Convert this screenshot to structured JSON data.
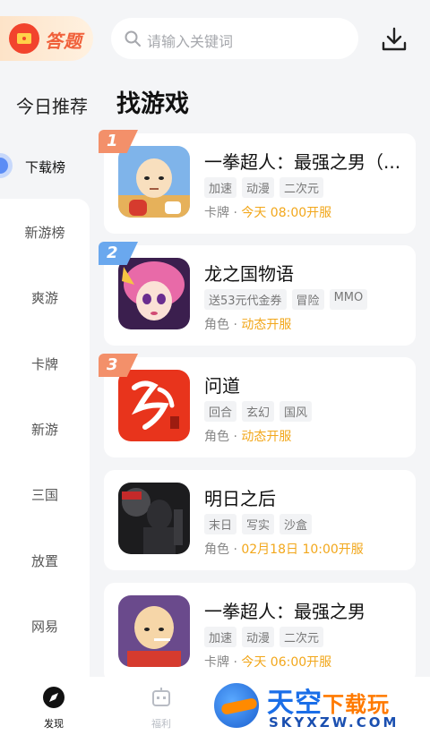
{
  "header": {
    "quiz_label": "答题",
    "search_placeholder": "请输入关键词"
  },
  "sidebar": {
    "today_label": "今日推荐",
    "active_label": "下载榜",
    "items": [
      "新游榜",
      "爽游",
      "卡牌",
      "新游",
      "三国",
      "放置",
      "网易"
    ]
  },
  "main": {
    "title": "找游戏",
    "games": [
      {
        "rank": "1",
        "name": "一拳超人：最强之男（...",
        "tags": [
          "加速",
          "动漫",
          "二次元"
        ],
        "category": "卡牌",
        "sep": "·",
        "time": "今天 08:00开服"
      },
      {
        "rank": "2",
        "name": "龙之国物语",
        "tags": [
          "送53元代金券",
          "冒险",
          "MMO"
        ],
        "category": "角色",
        "sep": "·",
        "time": "动态开服"
      },
      {
        "rank": "3",
        "name": "问道",
        "tags": [
          "回合",
          "玄幻",
          "国风"
        ],
        "category": "角色",
        "sep": "·",
        "time": "动态开服"
      },
      {
        "rank": "",
        "name": "明日之后",
        "tags": [
          "末日",
          "写实",
          "沙盒"
        ],
        "category": "角色",
        "sep": "·",
        "time": "02月18日 10:00开服"
      },
      {
        "rank": "",
        "name": "一拳超人：最强之男",
        "tags": [
          "加速",
          "动漫",
          "二次元"
        ],
        "category": "卡牌",
        "sep": "·",
        "time": "今天 06:00开服"
      }
    ]
  },
  "bottom_nav": {
    "discover": "发现",
    "welfare": "福利"
  },
  "watermark": {
    "title_blue": "天空",
    "title_orange": "下载玩",
    "domain": "SKYXZW.COM"
  },
  "colors": {
    "accent": "#5b8cf5",
    "highlight_time": "#f2a71b",
    "rank_orange": "#f3906a",
    "rank_blue": "#6aa8ee"
  }
}
